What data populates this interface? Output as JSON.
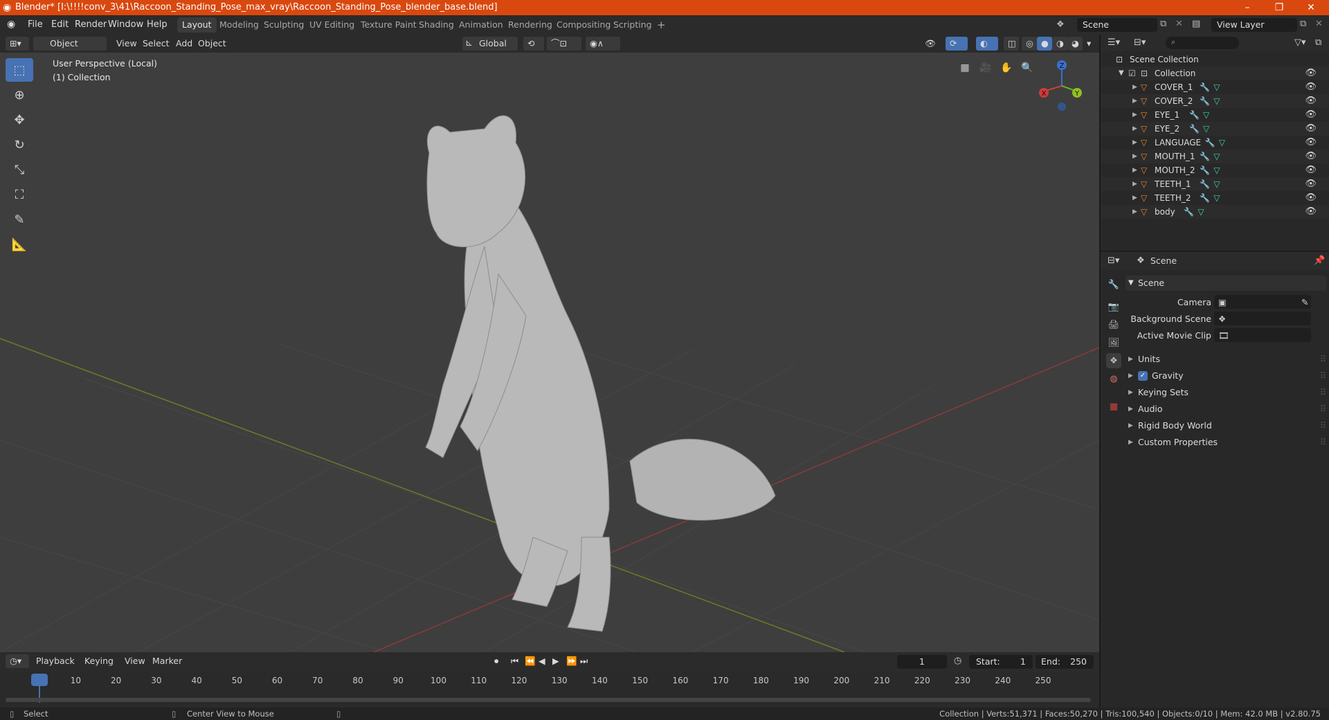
{
  "titlebar": {
    "title": "Blender* [I:\\!!!!conv_3\\41\\Raccoon_Standing_Pose_max_vray\\Raccoon_Standing_Pose_blender_base.blend]",
    "minimize": "–",
    "maximize": "❐",
    "close": "✕"
  },
  "menu": [
    "File",
    "Edit",
    "Render",
    "Window",
    "Help"
  ],
  "workspaces": [
    "Layout",
    "Modeling",
    "Sculpting",
    "UV Editing",
    "Texture Paint",
    "Shading",
    "Animation",
    "Rendering",
    "Compositing",
    "Scripting"
  ],
  "active_workspace": "Layout",
  "add_workspace": "+",
  "scene_field": "Scene",
  "view_layer_field": "View Layer",
  "viewport_header": {
    "mode": "Object Mode",
    "view": "View",
    "select": "Select",
    "add": "Add",
    "object": "Object",
    "transform": "Global"
  },
  "viewport": {
    "perspective": "User Perspective (Local)",
    "collection": "(1) Collection",
    "axis_x": "X",
    "axis_y": "Y",
    "axis_z": "Z"
  },
  "outliner": {
    "scene_collection": "Scene Collection",
    "collection": "Collection",
    "objects": [
      "COVER_1",
      "COVER_2",
      "EYE_1",
      "EYE_2",
      "LANGUAGE",
      "MOUTH_1",
      "MOUTH_2",
      "TEETH_1",
      "TEETH_2",
      "body"
    ]
  },
  "properties": {
    "context": "Scene",
    "panel_title": "Scene",
    "camera_label": "Camera",
    "bg_scene_label": "Background Scene",
    "movie_clip_label": "Active Movie Clip",
    "panels": [
      "Units",
      "Gravity",
      "Keying Sets",
      "Audio",
      "Rigid Body World",
      "Custom Properties"
    ],
    "gravity_checked": true
  },
  "timeline": {
    "playback": "Playback",
    "keying": "Keying",
    "view": "View",
    "marker": "Marker",
    "current_frame": "1",
    "start_label": "Start:",
    "start": "1",
    "end_label": "End:",
    "end": "250",
    "ticks": [
      "1",
      "10",
      "20",
      "30",
      "40",
      "50",
      "60",
      "70",
      "80",
      "90",
      "100",
      "110",
      "120",
      "130",
      "140",
      "150",
      "160",
      "170",
      "180",
      "190",
      "200",
      "210",
      "220",
      "230",
      "240",
      "250"
    ]
  },
  "status": {
    "select": "Select",
    "center_view": "Center View to Mouse",
    "stats": "Collection | Verts:51,371 | Faces:50,270 | Tris:100,540 | Objects:0/10 | Mem: 42.0 MB | v2.80.75"
  },
  "colors": {
    "accent": "#4772b3",
    "titlebar": "#d9480f",
    "object_icon": "#e8872a",
    "mesh_icon": "#3fd1b0",
    "modifier_icon": "#6fa8ff"
  }
}
